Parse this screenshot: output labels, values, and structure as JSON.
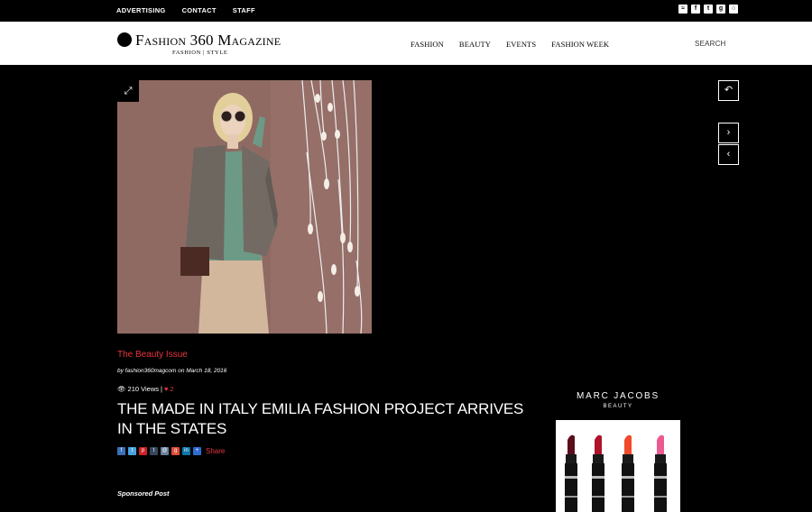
{
  "topbar": {
    "links": [
      "ADVERTISING",
      "CONTACT",
      "STAFF"
    ],
    "social_icons": [
      "rss-icon",
      "facebook-icon",
      "twitter-icon",
      "google-plus-icon",
      "instagram-icon"
    ]
  },
  "header": {
    "logo_title": "Fashion 360 Magazine",
    "logo_subtitle": "FASHION | STYLE",
    "nav": [
      "FASHION",
      "BEAUTY",
      "EVENTS",
      "FASHION WEEK"
    ],
    "search_label": "SEARCH"
  },
  "article": {
    "category": "The Beauty Issue",
    "byline": "by fashion360magcom on March 18, 2016",
    "views": "210 Views",
    "separator": "|",
    "likes": "2",
    "title": "THE MADE IN ITALY EMILIA FASHION PROJECT ARRIVES IN THE STATES",
    "share_label": "Share",
    "sponsored": "Sponsored Post"
  },
  "ad": {
    "brand": "MARC JACOBS",
    "sub": "BEAUTY"
  },
  "colors": {
    "accent": "#e8353f",
    "photo_bg": "#8f6a63"
  }
}
